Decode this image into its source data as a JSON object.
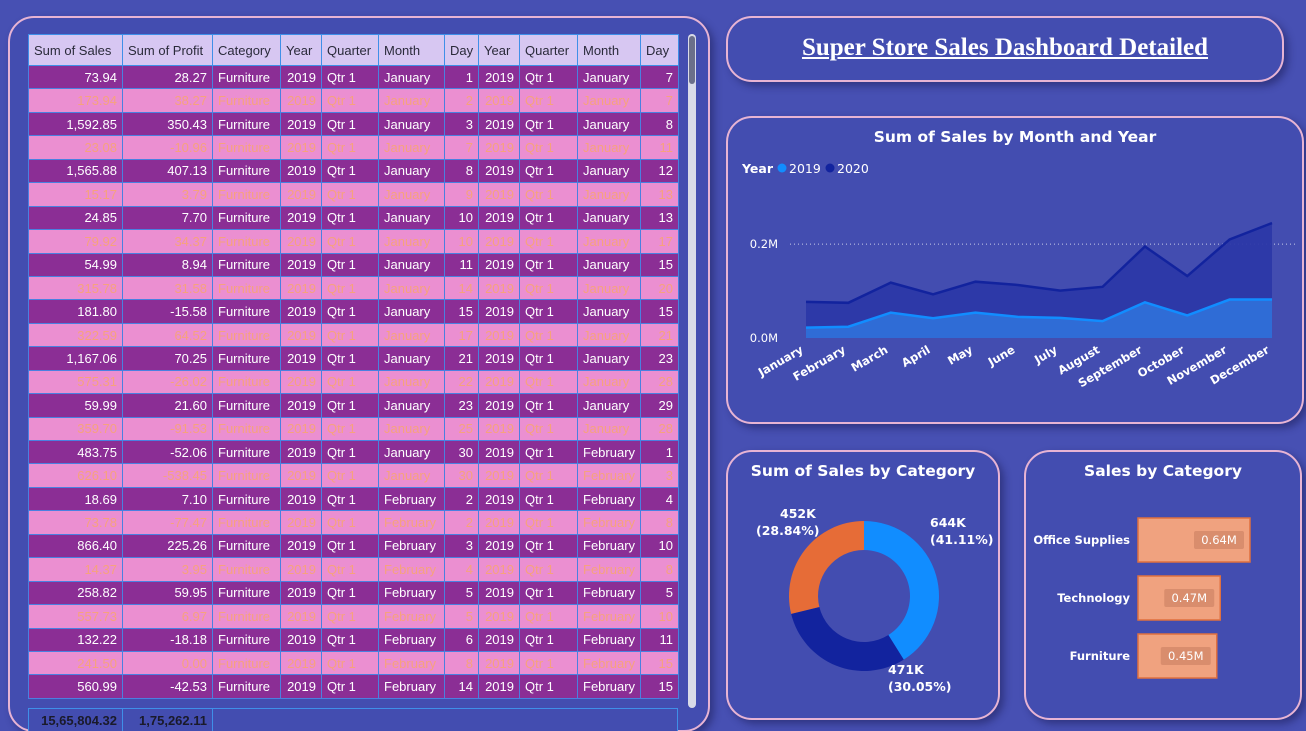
{
  "table": {
    "headers": [
      "Sum of Sales",
      "Sum of Profit",
      "Category",
      "Year",
      "Quarter",
      "Month",
      "Day",
      "Year",
      "Quarter",
      "Month",
      "Day"
    ],
    "rows": [
      [
        "73.94",
        "28.27",
        "Furniture",
        "2019",
        "Qtr 1",
        "January",
        "1",
        "2019",
        "Qtr 1",
        "January",
        "7"
      ],
      [
        "173.94",
        "38.27",
        "Furniture",
        "2019",
        "Qtr 1",
        "January",
        "2",
        "2019",
        "Qtr 1",
        "January",
        "7"
      ],
      [
        "1,592.85",
        "350.43",
        "Furniture",
        "2019",
        "Qtr 1",
        "January",
        "3",
        "2019",
        "Qtr 1",
        "January",
        "8"
      ],
      [
        "23.08",
        "-10.96",
        "Furniture",
        "2019",
        "Qtr 1",
        "January",
        "7",
        "2019",
        "Qtr 1",
        "January",
        "11"
      ],
      [
        "1,565.88",
        "407.13",
        "Furniture",
        "2019",
        "Qtr 1",
        "January",
        "8",
        "2019",
        "Qtr 1",
        "January",
        "12"
      ],
      [
        "15.17",
        "3.79",
        "Furniture",
        "2019",
        "Qtr 1",
        "January",
        "9",
        "2019",
        "Qtr 1",
        "January",
        "13"
      ],
      [
        "24.85",
        "7.70",
        "Furniture",
        "2019",
        "Qtr 1",
        "January",
        "10",
        "2019",
        "Qtr 1",
        "January",
        "13"
      ],
      [
        "79.92",
        "34.37",
        "Furniture",
        "2019",
        "Qtr 1",
        "January",
        "10",
        "2019",
        "Qtr 1",
        "January",
        "17"
      ],
      [
        "54.99",
        "8.94",
        "Furniture",
        "2019",
        "Qtr 1",
        "January",
        "11",
        "2019",
        "Qtr 1",
        "January",
        "15"
      ],
      [
        "315.78",
        "31.58",
        "Furniture",
        "2019",
        "Qtr 1",
        "January",
        "14",
        "2019",
        "Qtr 1",
        "January",
        "20"
      ],
      [
        "181.80",
        "-15.58",
        "Furniture",
        "2019",
        "Qtr 1",
        "January",
        "15",
        "2019",
        "Qtr 1",
        "January",
        "15"
      ],
      [
        "322.59",
        "64.52",
        "Furniture",
        "2019",
        "Qtr 1",
        "January",
        "17",
        "2019",
        "Qtr 1",
        "January",
        "21"
      ],
      [
        "1,167.06",
        "70.25",
        "Furniture",
        "2019",
        "Qtr 1",
        "January",
        "21",
        "2019",
        "Qtr 1",
        "January",
        "23"
      ],
      [
        "575.31",
        "-26.02",
        "Furniture",
        "2019",
        "Qtr 1",
        "January",
        "22",
        "2019",
        "Qtr 1",
        "January",
        "28"
      ],
      [
        "59.99",
        "21.60",
        "Furniture",
        "2019",
        "Qtr 1",
        "January",
        "23",
        "2019",
        "Qtr 1",
        "January",
        "29"
      ],
      [
        "359.70",
        "-91.53",
        "Furniture",
        "2019",
        "Qtr 1",
        "January",
        "25",
        "2019",
        "Qtr 1",
        "January",
        "28"
      ],
      [
        "483.75",
        "-52.06",
        "Furniture",
        "2019",
        "Qtr 1",
        "January",
        "30",
        "2019",
        "Qtr 1",
        "February",
        "1"
      ],
      [
        "626.10",
        "-538.45",
        "Furniture",
        "2019",
        "Qtr 1",
        "January",
        "30",
        "2019",
        "Qtr 1",
        "February",
        "3"
      ],
      [
        "18.69",
        "7.10",
        "Furniture",
        "2019",
        "Qtr 1",
        "February",
        "2",
        "2019",
        "Qtr 1",
        "February",
        "4"
      ],
      [
        "73.78",
        "-77.47",
        "Furniture",
        "2019",
        "Qtr 1",
        "February",
        "2",
        "2019",
        "Qtr 1",
        "February",
        "8"
      ],
      [
        "866.40",
        "225.26",
        "Furniture",
        "2019",
        "Qtr 1",
        "February",
        "3",
        "2019",
        "Qtr 1",
        "February",
        "10"
      ],
      [
        "14.37",
        "3.95",
        "Furniture",
        "2019",
        "Qtr 1",
        "February",
        "4",
        "2019",
        "Qtr 1",
        "February",
        "8"
      ],
      [
        "258.82",
        "59.95",
        "Furniture",
        "2019",
        "Qtr 1",
        "February",
        "5",
        "2019",
        "Qtr 1",
        "February",
        "5"
      ],
      [
        "557.73",
        "6.97",
        "Furniture",
        "2019",
        "Qtr 1",
        "February",
        "5",
        "2019",
        "Qtr 1",
        "February",
        "10"
      ],
      [
        "132.22",
        "-18.18",
        "Furniture",
        "2019",
        "Qtr 1",
        "February",
        "6",
        "2019",
        "Qtr 1",
        "February",
        "11"
      ],
      [
        "241.50",
        "0.00",
        "Furniture",
        "2019",
        "Qtr 1",
        "February",
        "8",
        "2019",
        "Qtr 1",
        "February",
        "15"
      ],
      [
        "560.99",
        "-42.53",
        "Furniture",
        "2019",
        "Qtr 1",
        "February",
        "14",
        "2019",
        "Qtr 1",
        "February",
        "15"
      ]
    ],
    "totals": [
      "15,65,804.32",
      "1,75,262.11"
    ]
  },
  "dashboard_title": "Super Store Sales Dashboard Detailed",
  "charts": {
    "line": {
      "type": "area",
      "title": "Sum of Sales by Month and Year",
      "legend_title": "Year",
      "legend_position": "top-left",
      "categories": [
        "January",
        "February",
        "March",
        "April",
        "May",
        "June",
        "July",
        "August",
        "September",
        "October",
        "November",
        "December"
      ],
      "series": [
        {
          "name": "2019",
          "color": "#118dff",
          "values": [
            0.022,
            0.024,
            0.054,
            0.042,
            0.054,
            0.045,
            0.043,
            0.036,
            0.076,
            0.048,
            0.082,
            0.082
          ]
        },
        {
          "name": "2020",
          "color": "#12239e",
          "values": [
            0.077,
            0.075,
            0.118,
            0.093,
            0.12,
            0.113,
            0.101,
            0.109,
            0.195,
            0.132,
            0.21,
            0.245
          ]
        }
      ],
      "y_ticks": [
        "0.2M",
        "0.0M"
      ],
      "y_tick_values": [
        0.2,
        0.0
      ],
      "ylim": [
        0,
        0.26
      ],
      "gridlines": true
    },
    "donut": {
      "type": "pie",
      "title": "Sum of Sales by Category",
      "slices": [
        {
          "label_value": "644K",
          "label_pct": "(41.11%)",
          "value": 41.11,
          "color": "#118dff"
        },
        {
          "label_value": "471K",
          "label_pct": "(30.05%)",
          "value": 30.05,
          "color": "#12239e"
        },
        {
          "label_value": "452K",
          "label_pct": "(28.84%)",
          "value": 28.84,
          "color": "#e66c37"
        }
      ]
    },
    "bar": {
      "type": "bar",
      "orientation": "horizontal",
      "title": "Sales by Category",
      "categories": [
        "Office Supplies",
        "Technology",
        "Furniture"
      ],
      "values": [
        0.64,
        0.47,
        0.45
      ],
      "data_labels": [
        "0.64M",
        "0.47M",
        "0.45M"
      ],
      "bar_color": "#f0a27f",
      "xlim": [
        0,
        0.64
      ]
    }
  }
}
